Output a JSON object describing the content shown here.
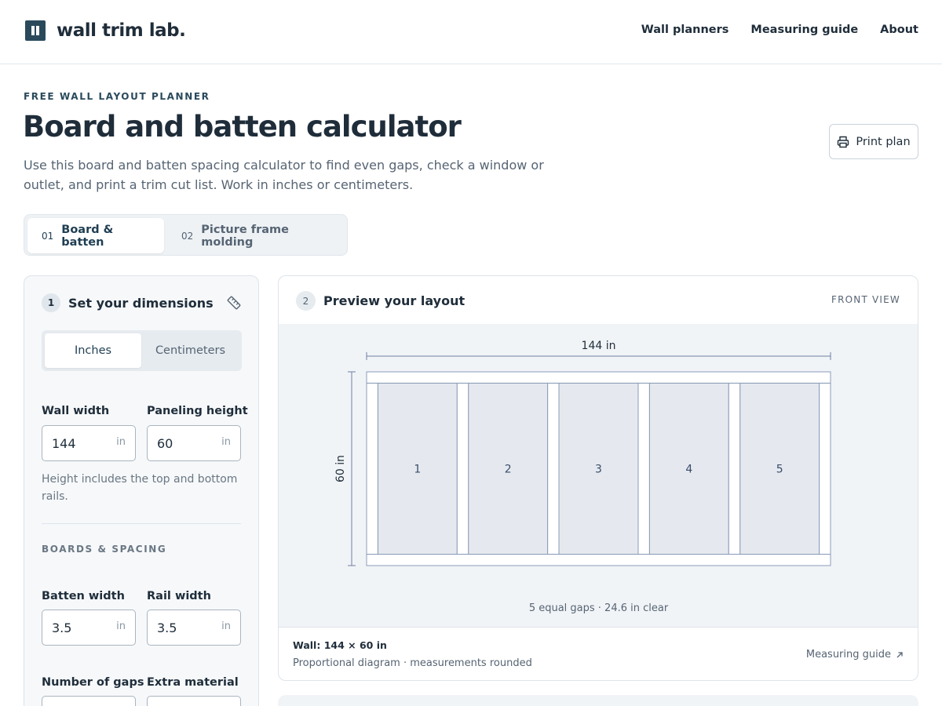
{
  "header": {
    "brand": "wall trim lab.",
    "nav": [
      "Wall planners",
      "Measuring guide",
      "About"
    ]
  },
  "hero": {
    "eyebrow": "FREE WALL LAYOUT PLANNER",
    "title": "Board and batten calculator",
    "lede": "Use this board and batten spacing calculator to find even gaps, check a window or outlet, and print a trim cut list. Work in inches or centimeters.",
    "print_label": "Print plan"
  },
  "mode_tabs": [
    {
      "num": "01",
      "label": "Board & batten",
      "active": true
    },
    {
      "num": "02",
      "label": "Picture frame molding",
      "active": false
    }
  ],
  "dimensions": {
    "step": "1",
    "title": "Set your dimensions",
    "units": [
      "Inches",
      "Centimeters"
    ],
    "selected_unit": "Inches",
    "wall_width_label": "Wall width",
    "wall_width_value": "144",
    "paneling_height_label": "Paneling height",
    "paneling_height_value": "60",
    "unit_suffix": "in",
    "help": "Height includes the top and bottom rails.",
    "boards_section": "BOARDS & SPACING",
    "batten_width_label": "Batten width",
    "batten_width_value": "3.5",
    "rail_width_label": "Rail width",
    "rail_width_value": "3.5",
    "gaps_label": "Number of gaps",
    "extra_label": "Extra material"
  },
  "preview": {
    "step": "2",
    "title": "Preview your layout",
    "view": "FRONT VIEW",
    "width_dim": "144 in",
    "height_dim": "60 in",
    "panel_labels": [
      "1",
      "2",
      "3",
      "4",
      "5"
    ],
    "summary": "5 equal gaps · 24.6 in clear",
    "wall": "Wall: 144 × 60 in",
    "note": "Proportional diagram · measurements rounded",
    "link": "Measuring guide",
    "layout": {
      "wall_width": 144,
      "paneling_height": 60,
      "batten_width": 3.5,
      "rail_width": 3.5,
      "gaps": 5
    }
  },
  "colors": {
    "brand": "#2a4a5c",
    "text": "#1f2d3a",
    "muted": "#566473",
    "panel_fill": "#e5e9ef",
    "board_stroke": "#8a9cb8",
    "dim_line": "#6e7fa3"
  },
  "icons": {
    "brand": "logo-mark-icon",
    "print": "printer-icon",
    "ruler": "ruler-icon",
    "external": "arrow-up-right-icon"
  }
}
